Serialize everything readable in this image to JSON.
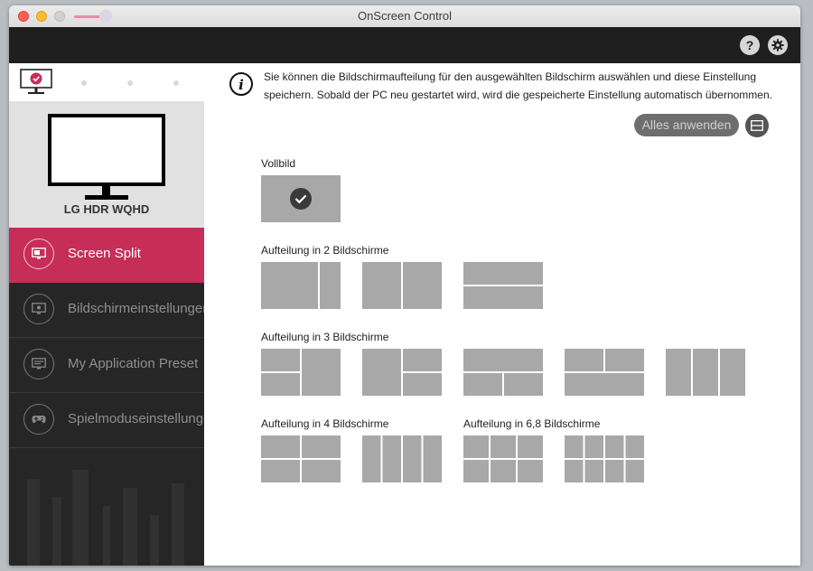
{
  "window": {
    "title": "OnScreen Control"
  },
  "topbar": {
    "help_label": "?",
    "settings_icon": "gear-icon"
  },
  "sidebar": {
    "monitor_name": "LG HDR WQHD",
    "nav": [
      {
        "label": "Screen Split",
        "icon": "screen-split-icon",
        "active": true
      },
      {
        "label": "Bildschirmeinstellungen",
        "icon": "display-settings-icon",
        "active": false
      },
      {
        "label": "My Application Preset",
        "icon": "app-preset-icon",
        "active": false
      },
      {
        "label": "Spielmoduseinstellungen",
        "icon": "gamepad-icon",
        "active": false
      }
    ]
  },
  "content": {
    "info_text": "Sie können die Bildschirmaufteilung für den ausgewählten Bildschirm auswählen und diese Einstellung speichern. Sobald der PC neu gestartet wird, wird die gespeicherte Einstellung automatisch übernommen.",
    "apply_all_label": "Alles anwenden",
    "sections": {
      "fullscreen": "Vollbild",
      "split2": "Aufteilung in 2 Bildschirme",
      "split3": "Aufteilung in 3 Bildschirme",
      "split4": "Aufteilung in 4 Bildschirme",
      "split68": "Aufteilung in 6,8 Bildschirme"
    }
  },
  "colors": {
    "accent": "#c62e57",
    "sidebar_bg": "#262626",
    "tile": "#a8a8a8"
  }
}
